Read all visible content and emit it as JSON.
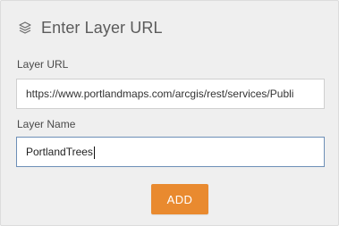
{
  "panel": {
    "title": "Enter Layer URL",
    "title_icon": "layers-icon"
  },
  "fields": {
    "url": {
      "label": "Layer URL",
      "value": "https://www.portlandmaps.com/arcgis/rest/services/Publi"
    },
    "name": {
      "label": "Layer Name",
      "value": "PortlandTrees"
    }
  },
  "actions": {
    "add_label": "ADD"
  },
  "colors": {
    "background": "#efefef",
    "button": "#e98a2f",
    "focused_border": "#6d8fb7",
    "text": "#5b5b5b"
  }
}
